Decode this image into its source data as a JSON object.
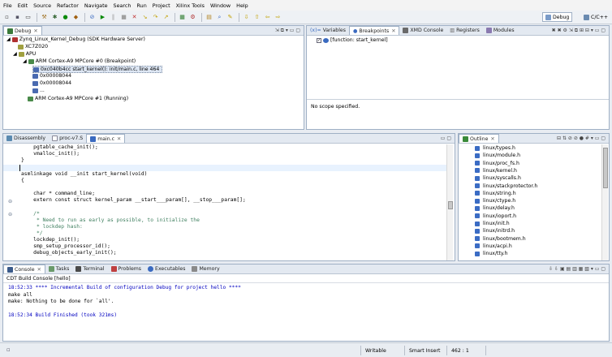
{
  "menu": [
    "File",
    "Edit",
    "Source",
    "Refactor",
    "Navigate",
    "Search",
    "Run",
    "Project",
    "Xilinx Tools",
    "Window",
    "Help"
  ],
  "perspectives": {
    "debug": "Debug",
    "cpp": "C/C++"
  },
  "debug": {
    "tab": "Debug",
    "tree": [
      {
        "label": "Zynq_Linux_Kernel_Debug (SDK Hardware Server)",
        "level": 0
      },
      {
        "label": "XC7Z020",
        "level": 1
      },
      {
        "label": "APU",
        "level": 1
      },
      {
        "label": "ARM Cortex-A9 MPCore #0 (Breakpoint)",
        "level": 2
      },
      {
        "label": "0xc040b4cc start_kernel(): init/main.c, line 464",
        "level": 3
      },
      {
        "label": "0x00008044",
        "level": 3
      },
      {
        "label": "0x00008044",
        "level": 3
      },
      {
        "label": "...",
        "level": 3
      },
      {
        "label": "ARM Cortex-A9 MPCore #1 (Running)",
        "level": 2
      }
    ]
  },
  "bp": {
    "tabs": [
      "Variables",
      "Breakpoints",
      "XMD Console",
      "Registers",
      "Modules"
    ],
    "item": "[function: start_kernel]",
    "noscope": "No scope specified."
  },
  "editor": {
    "tabs": [
      "Disassembly",
      "proc-v7.S",
      "main.c"
    ],
    "lines": [
      "    pgtable_cache_init();",
      "    vmalloc_init();",
      "}",
      "",
      "asmlinkage void __init start_kernel(void)",
      "{",
      "    char * command_line;",
      "    extern const struct kernel_param __start___param[], __stop___param[];",
      "",
      "    /*",
      "     * Need to run as early as possible, to initialize the",
      "     * lockdep hash:",
      "     */",
      "    lockdep_init();",
      "    smp_setup_processor_id();",
      "    debug_objects_early_init();"
    ]
  },
  "outline": {
    "tab": "Outline",
    "items": [
      "linux/types.h",
      "linux/module.h",
      "linux/proc_fs.h",
      "linux/kernel.h",
      "linux/syscalls.h",
      "linux/stackprotector.h",
      "linux/string.h",
      "linux/ctype.h",
      "linux/delay.h",
      "linux/ioport.h",
      "linux/init.h",
      "linux/initrd.h",
      "linux/bootmem.h",
      "linux/acpi.h",
      "linux/tty.h"
    ]
  },
  "console": {
    "tabs": [
      "Console",
      "Tasks",
      "Terminal",
      "Problems",
      "Executables",
      "Memory"
    ],
    "header": "CDT Build Console [hello]",
    "lines": [
      {
        "text": "18:52:33 **** Incremental Build of configuration Debug for project hello ****",
        "color": "#0000c0"
      },
      {
        "text": "make all",
        "color": "#000000"
      },
      {
        "text": "make: Nothing to be done for `all'.",
        "color": "#000000"
      },
      {
        "text": "",
        "color": "#000000"
      },
      {
        "text": "18:52:34 Build Finished (took 321ms)",
        "color": "#0000c0"
      }
    ]
  },
  "status": {
    "writable": "Writable",
    "insert": "Smart Insert",
    "pos": "462 : 1"
  }
}
